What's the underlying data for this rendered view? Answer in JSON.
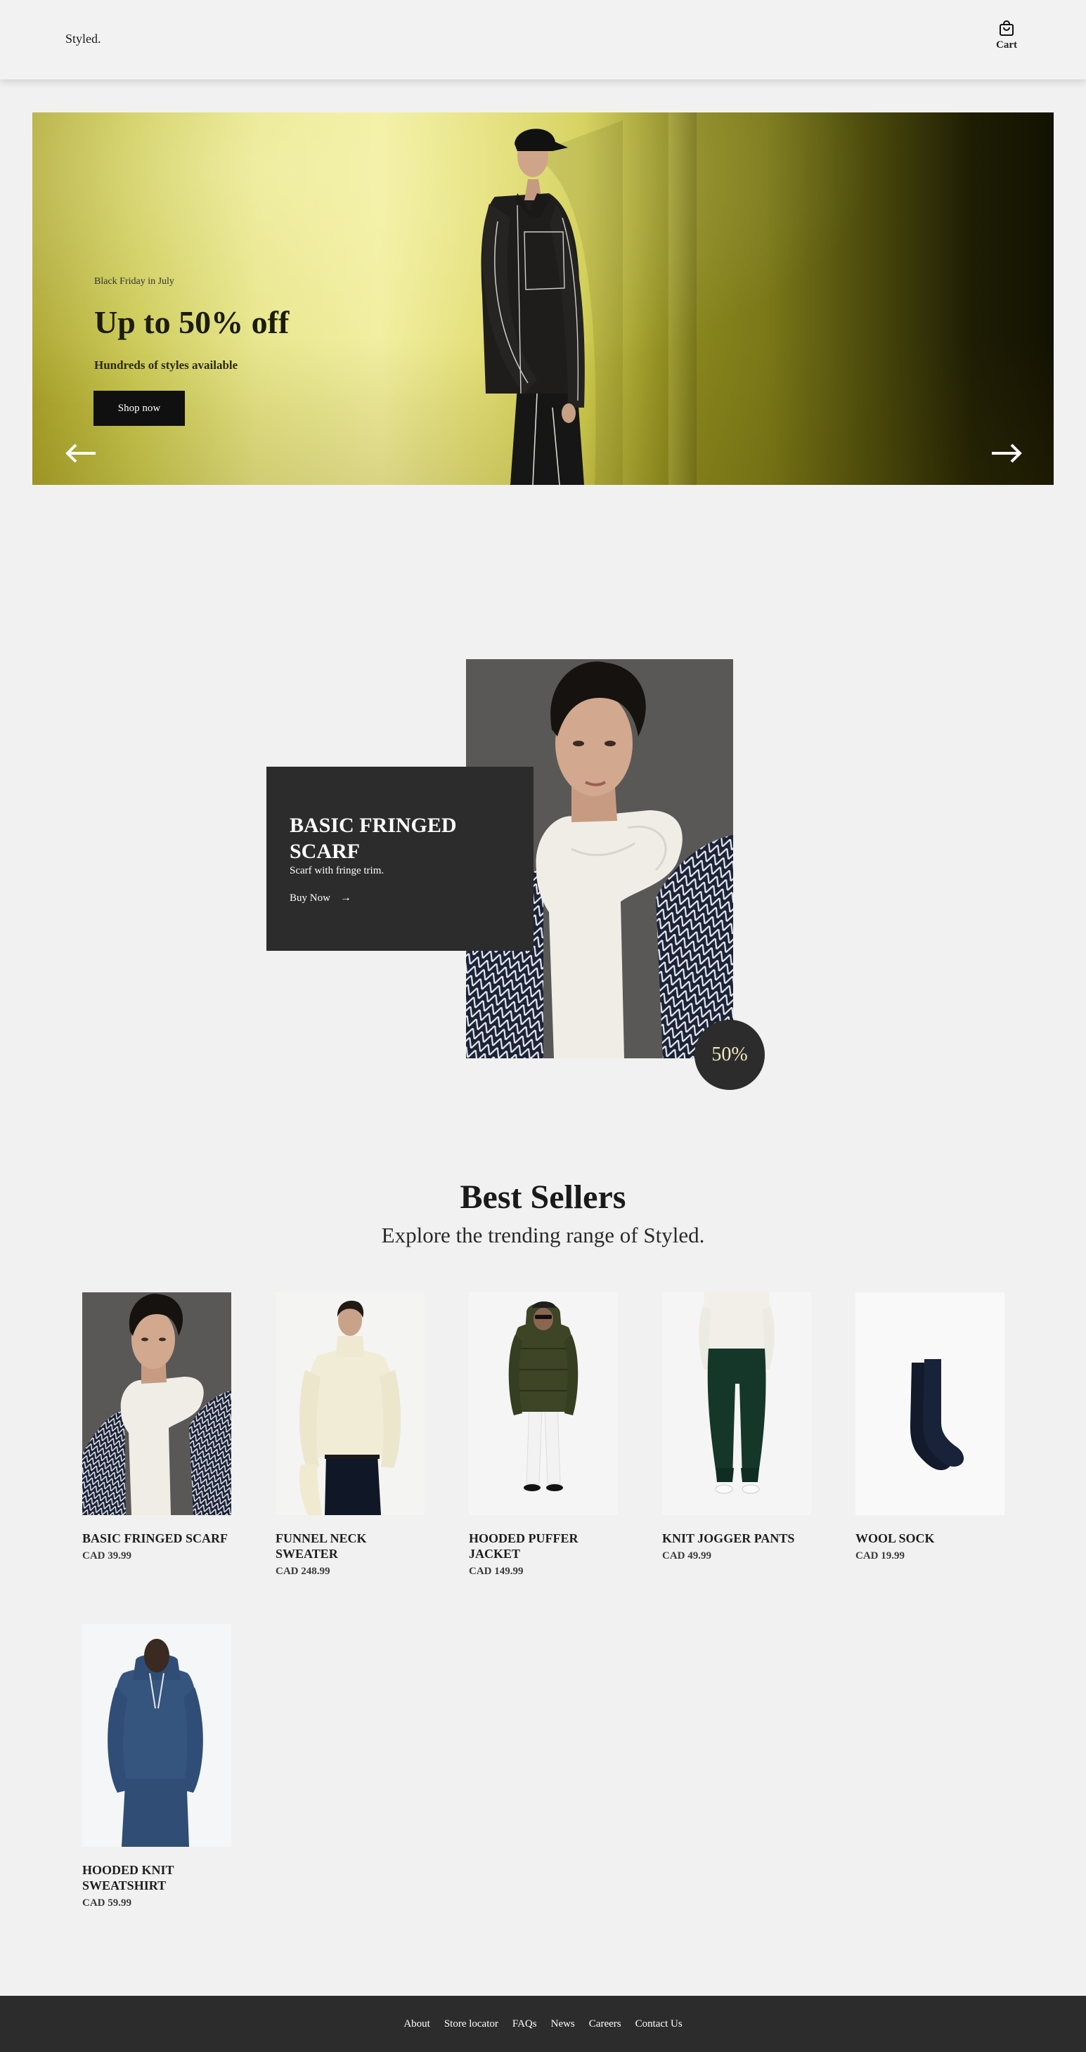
{
  "header": {
    "logo": "Styled.",
    "cart_label": "Cart",
    "cart_icon": "shopping-bag-icon"
  },
  "hero": {
    "eyebrow": "Black Friday in July",
    "title": "Up to 50% off",
    "subtitle": "Hundreds of styles available",
    "button_label": "Shop now",
    "prev_icon": "arrow-left-icon",
    "next_icon": "arrow-right-icon",
    "background_colors": [
      "#e6e487",
      "#131202"
    ]
  },
  "featured": {
    "title": "BASIC FRINGED SCARF",
    "description": "Scarf with fringe trim.",
    "link_label": "Buy Now",
    "link_arrow": "→",
    "badge": "50%",
    "card_color": "#2c2c2c"
  },
  "best_sellers": {
    "title": "Best Sellers",
    "subtitle": "Explore the trending range of Styled.",
    "products": [
      {
        "name": "Basic Fringed Scarf",
        "price": "CAD 39.99"
      },
      {
        "name": "Funnel Neck Sweater",
        "price": "CAD 248.99"
      },
      {
        "name": "Hooded Puffer Jacket",
        "price": "CAD 149.99"
      },
      {
        "name": "Knit Jogger Pants",
        "price": "CAD 49.99"
      },
      {
        "name": "Wool Sock",
        "price": "CAD 19.99"
      },
      {
        "name": "Hooded Knit Sweatshirt",
        "price": "CAD 59.99"
      }
    ]
  },
  "footer": {
    "links": [
      "About",
      "Store locator",
      "FAQs",
      "News",
      "Careers",
      "Contact Us"
    ]
  }
}
